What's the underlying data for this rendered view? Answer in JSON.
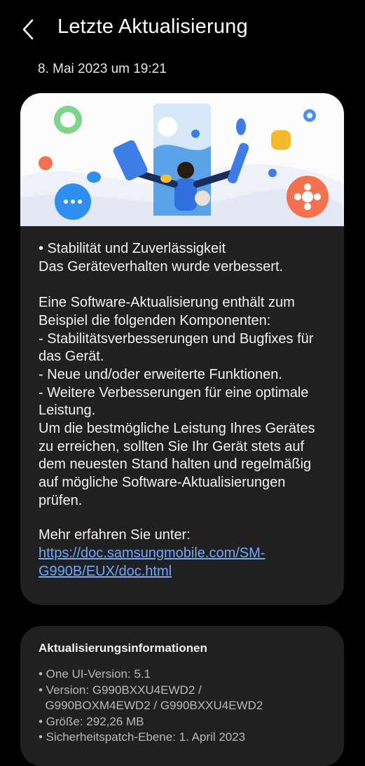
{
  "header": {
    "back_icon": "chevron-left-icon",
    "title": "Letzte Aktualisierung"
  },
  "date": "8. Mai 2023 um 19:21",
  "release_notes": {
    "illustration": "software-update-illustration",
    "body": "• Stabilität und Zuverlässigkeit\nDas Geräteverhalten wurde verbessert.\n\nEine Software-Aktualisierung enthält zum Beispiel die folgenden Komponenten:\n - Stabilitätsverbesserungen und Bugfixes für das Gerät.\n - Neue und/oder erweiterte Funktionen.\n - Weitere Verbesserungen für eine optimale Leistung.\nUm die bestmögliche Leistung Ihres Gerätes zu erreichen, sollten Sie Ihr Gerät stets auf dem neuesten Stand halten und regelmäßig auf mögliche Software-Aktualisierungen prüfen.",
    "learn_more": "Mehr erfahren Sie unter:",
    "link": "https://doc.samsungmobile.com/SM-G990B/EUX/doc.html"
  },
  "update_info": {
    "title": "Aktualisierungsinformationen",
    "items": [
      "• One UI-Version: 5.1",
      "• Version: G990BXXU4EWD2 /",
      "  G990BOXM4EWD2 / G990BXXU4EWD2",
      "• Größe: 292,26 MB",
      "• Sicherheitspatch-Ebene: 1. April 2023"
    ]
  },
  "colors": {
    "background": "#000000",
    "card": "#202020",
    "link": "#6ea8ff"
  }
}
